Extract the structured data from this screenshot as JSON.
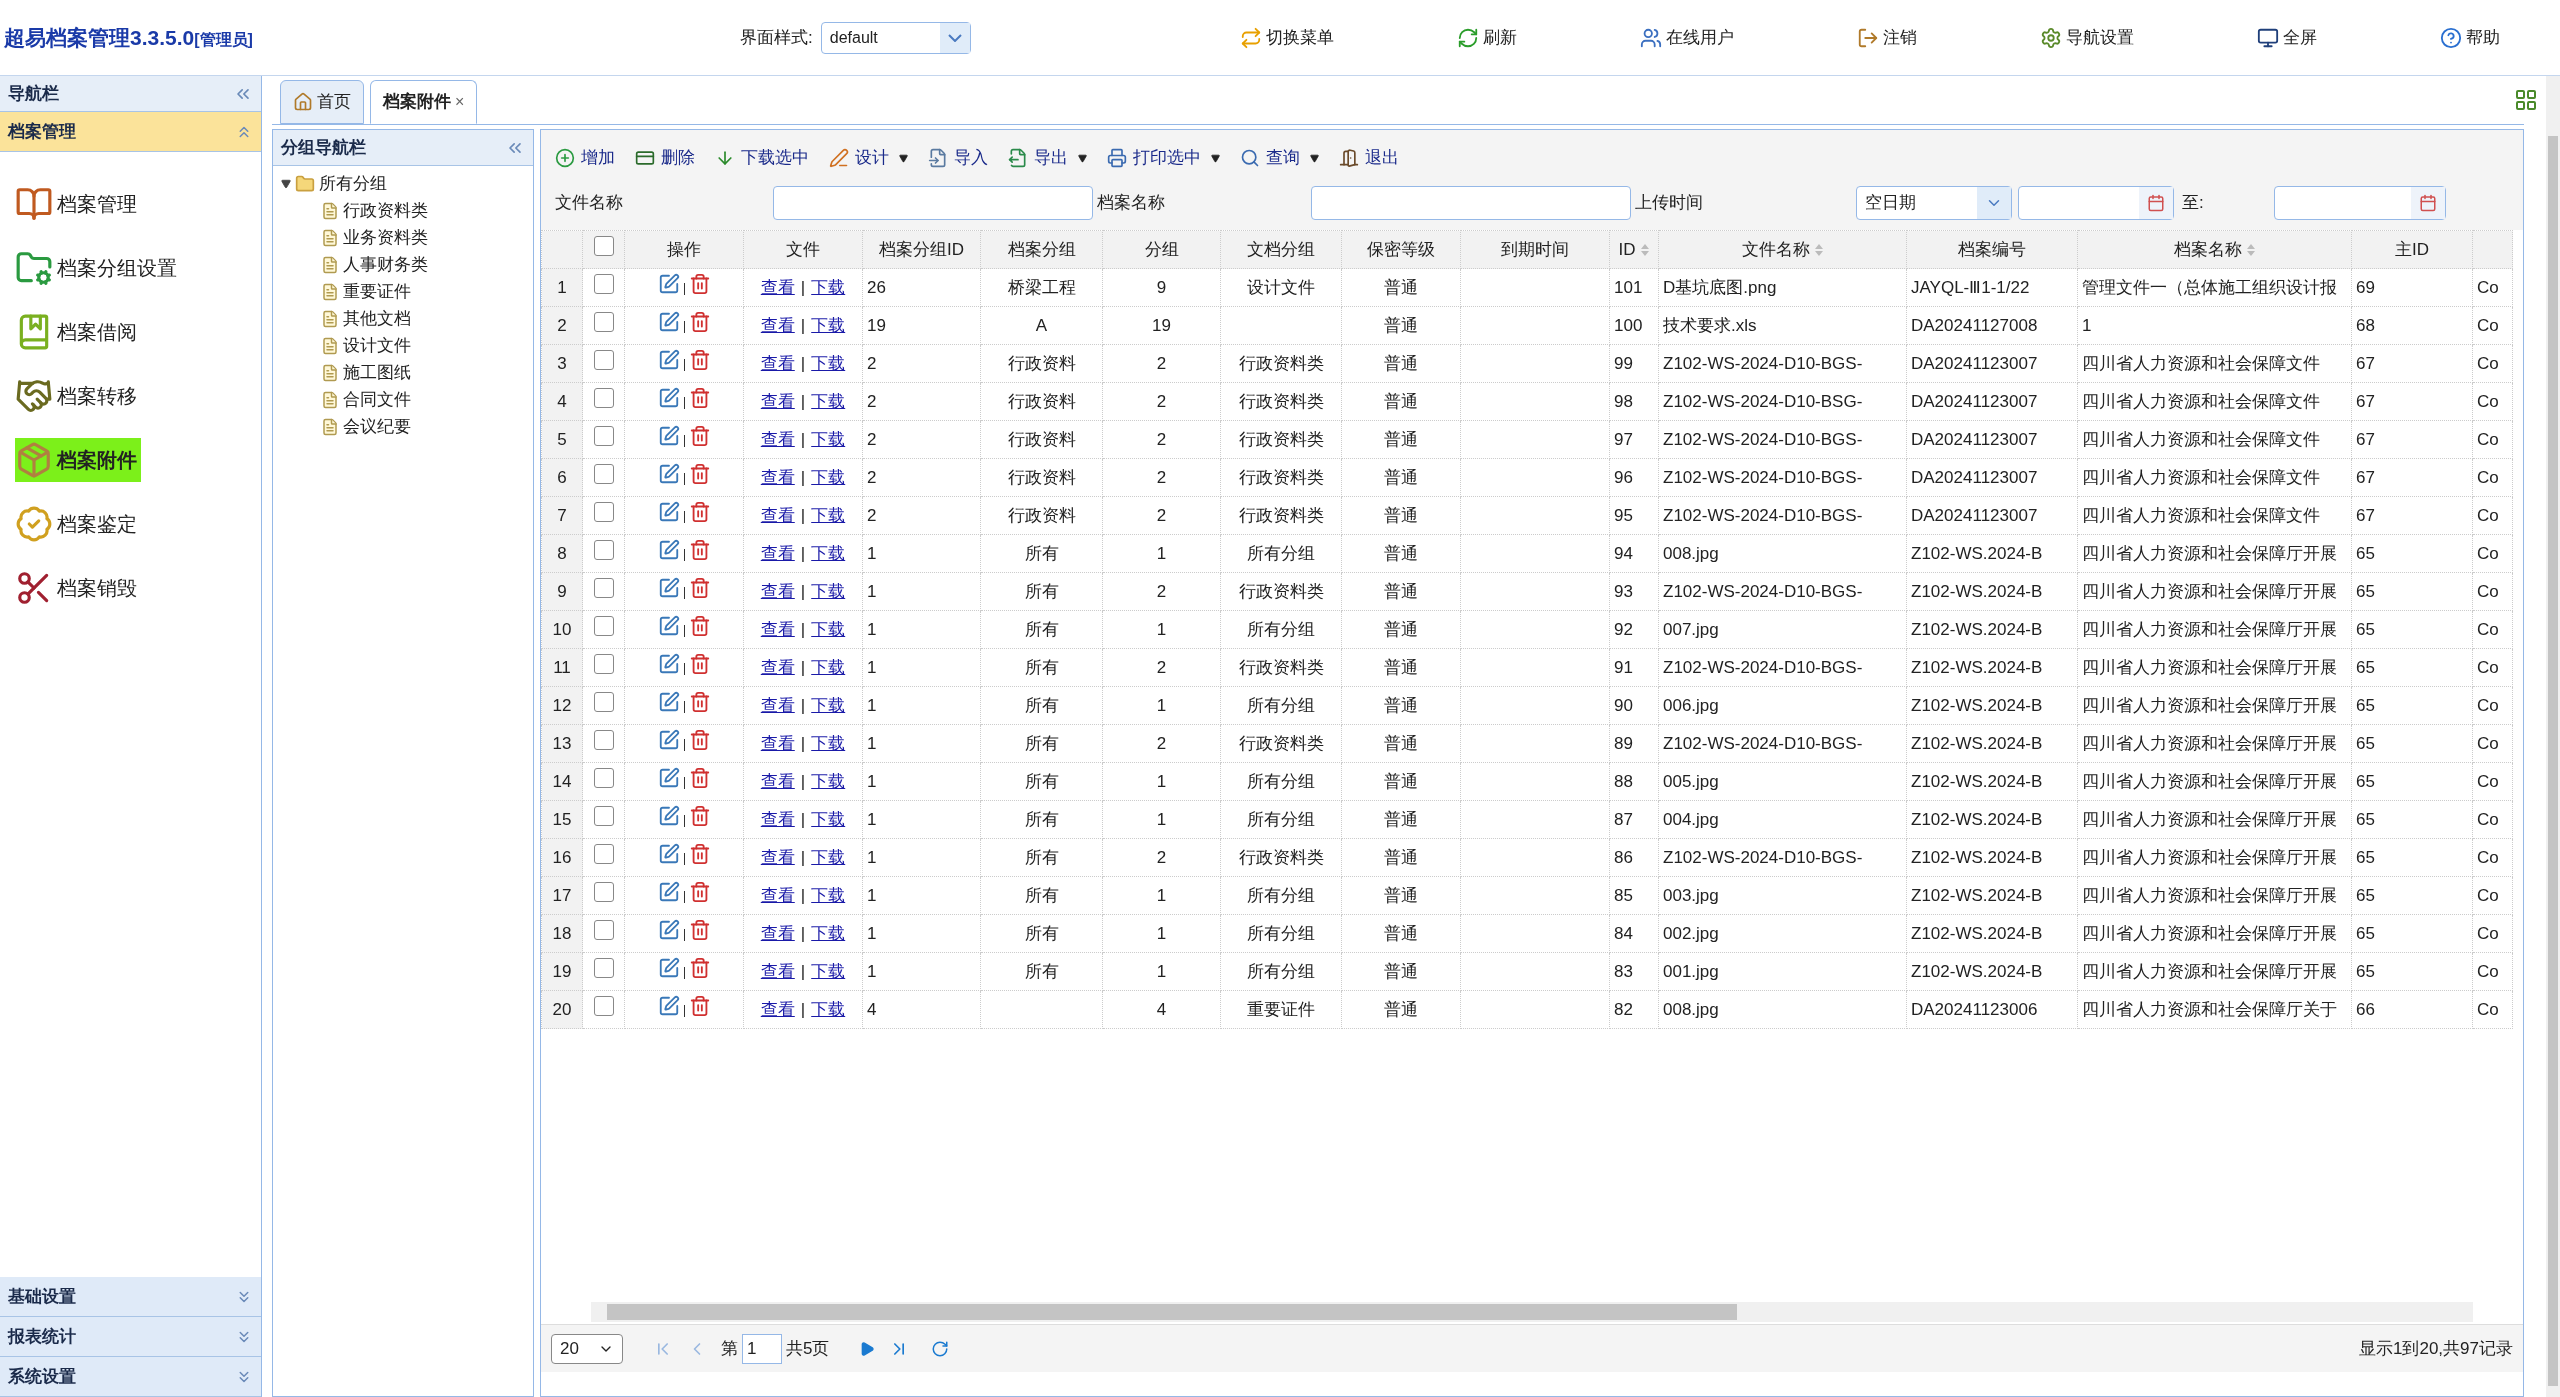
{
  "header": {
    "title": "超易档案管理3.3.5.0",
    "role": "[管理员]",
    "style_label": "界面样式:",
    "style_value": "default",
    "menu": [
      {
        "label": "切换菜单"
      },
      {
        "label": "刷新"
      },
      {
        "label": "在线用户"
      },
      {
        "label": "注销"
      },
      {
        "label": "导航设置"
      },
      {
        "label": "全屏"
      },
      {
        "label": "帮助"
      }
    ]
  },
  "nav": {
    "title": "导航栏",
    "sections_top": [
      {
        "label": "档案管理",
        "expanded": true
      }
    ],
    "items": [
      {
        "label": "档案管理",
        "selected": false
      },
      {
        "label": "档案分组设置",
        "selected": false
      },
      {
        "label": "档案借阅",
        "selected": false
      },
      {
        "label": "档案转移",
        "selected": false
      },
      {
        "label": "档案附件",
        "selected": true
      },
      {
        "label": "档案鉴定",
        "selected": false
      },
      {
        "label": "档案销毁",
        "selected": false
      }
    ],
    "sections_bottom": [
      {
        "label": "基础设置",
        "expanded": false
      },
      {
        "label": "报表统计",
        "expanded": false
      },
      {
        "label": "系统设置",
        "expanded": false
      }
    ]
  },
  "tabs": [
    {
      "label": "首页",
      "selected": false
    },
    {
      "label": "档案附件",
      "selected": true,
      "close": "×"
    }
  ],
  "group_nav": {
    "title": "分组导航栏",
    "tree": {
      "label": "所有分组",
      "expanded": true,
      "children": [
        {
          "label": "行政资料类"
        },
        {
          "label": "业务资料类"
        },
        {
          "label": "人事财务类"
        },
        {
          "label": "重要证件"
        },
        {
          "label": "其他文档"
        },
        {
          "label": "设计文件"
        },
        {
          "label": "施工图纸"
        },
        {
          "label": "合同文件"
        },
        {
          "label": "会议纪要"
        }
      ]
    }
  },
  "toolbar": [
    {
      "label": "增加",
      "dropdown": false
    },
    {
      "label": "删除",
      "dropdown": false
    },
    {
      "label": "下载选中",
      "dropdown": false
    },
    {
      "label": "设计",
      "dropdown": true
    },
    {
      "label": "导入",
      "dropdown": false
    },
    {
      "label": "导出",
      "dropdown": true
    },
    {
      "label": "打印选中",
      "dropdown": true
    },
    {
      "label": "查询",
      "dropdown": true
    },
    {
      "label": "退出",
      "dropdown": false
    }
  ],
  "filters": {
    "file_name_label": "文件名称",
    "archive_name_label": "档案名称",
    "upload_label": "上传时间",
    "date_mode": "空日期",
    "to_label": "至:"
  },
  "table": {
    "header_checked": false,
    "action_columns": [
      {
        "label": "操作"
      },
      {
        "label": "文件"
      }
    ],
    "columns": [
      {
        "label": "档案分组ID",
        "sortable": false
      },
      {
        "label": "档案分组",
        "sortable": false
      },
      {
        "label": "分组",
        "sortable": false
      },
      {
        "label": "文档分组",
        "sortable": false
      },
      {
        "label": "保密等级",
        "sortable": false
      },
      {
        "label": "到期时间",
        "sortable": false
      },
      {
        "label": "ID",
        "sortable": true
      },
      {
        "label": "文件名称",
        "sortable": true
      },
      {
        "label": "档案编号",
        "sortable": false
      },
      {
        "label": "档案名称",
        "sortable": true
      },
      {
        "label": "主ID",
        "sortable": false
      },
      {
        "sortable": false
      }
    ],
    "rows": [
      {
        "num": "1",
        "checked": false,
        "view": "查看",
        "sep": "|",
        "download": "下载",
        "cells": [
          "26",
          "桥梁工程",
          "9",
          "设计文件",
          "普通",
          null,
          "101",
          "D基坑底图.png",
          "JAYQL-Ⅲ1-1/22",
          "管理文件一（总体施工组织设计报",
          "69",
          "Co"
        ]
      },
      {
        "num": "2",
        "checked": false,
        "view": "查看",
        "sep": "|",
        "download": "下载",
        "cells": [
          "19",
          "A",
          "19",
          null,
          "普通",
          null,
          "100",
          "技术要求.xls",
          "DA20241127008",
          "1",
          "68",
          "Co"
        ]
      },
      {
        "num": "3",
        "checked": false,
        "view": "查看",
        "sep": "|",
        "download": "下载",
        "cells": [
          "2",
          "行政资料",
          "2",
          "行政资料类",
          "普通",
          null,
          "99",
          "Z102-WS-2024-D10-BGS-",
          "DA20241123007",
          "四川省人力资源和社会保障文件",
          "67",
          "Co"
        ]
      },
      {
        "num": "4",
        "checked": false,
        "view": "查看",
        "sep": "|",
        "download": "下载",
        "cells": [
          "2",
          "行政资料",
          "2",
          "行政资料类",
          "普通",
          null,
          "98",
          "Z102-WS-2024-D10-BSG-",
          "DA20241123007",
          "四川省人力资源和社会保障文件",
          "67",
          "Co"
        ]
      },
      {
        "num": "5",
        "checked": false,
        "view": "查看",
        "sep": "|",
        "download": "下载",
        "cells": [
          "2",
          "行政资料",
          "2",
          "行政资料类",
          "普通",
          null,
          "97",
          "Z102-WS-2024-D10-BGS-",
          "DA20241123007",
          "四川省人力资源和社会保障文件",
          "67",
          "Co"
        ]
      },
      {
        "num": "6",
        "checked": false,
        "view": "查看",
        "sep": "|",
        "download": "下载",
        "cells": [
          "2",
          "行政资料",
          "2",
          "行政资料类",
          "普通",
          null,
          "96",
          "Z102-WS-2024-D10-BGS-",
          "DA20241123007",
          "四川省人力资源和社会保障文件",
          "67",
          "Co"
        ]
      },
      {
        "num": "7",
        "checked": false,
        "view": "查看",
        "sep": "|",
        "download": "下载",
        "cells": [
          "2",
          "行政资料",
          "2",
          "行政资料类",
          "普通",
          null,
          "95",
          "Z102-WS-2024-D10-BGS-",
          "DA20241123007",
          "四川省人力资源和社会保障文件",
          "67",
          "Co"
        ]
      },
      {
        "num": "8",
        "checked": false,
        "view": "查看",
        "sep": "|",
        "download": "下载",
        "cells": [
          "1",
          "所有",
          "1",
          "所有分组",
          "普通",
          null,
          "94",
          "008.jpg",
          "Z102-WS.2024-B",
          "四川省人力资源和社会保障厅开展",
          "65",
          "Co"
        ]
      },
      {
        "num": "9",
        "checked": false,
        "view": "查看",
        "sep": "|",
        "download": "下载",
        "cells": [
          "1",
          "所有",
          "2",
          "行政资料类",
          "普通",
          null,
          "93",
          "Z102-WS-2024-D10-BGS-",
          "Z102-WS.2024-B",
          "四川省人力资源和社会保障厅开展",
          "65",
          "Co"
        ]
      },
      {
        "num": "10",
        "checked": false,
        "view": "查看",
        "sep": "|",
        "download": "下载",
        "cells": [
          "1",
          "所有",
          "1",
          "所有分组",
          "普通",
          null,
          "92",
          "007.jpg",
          "Z102-WS.2024-B",
          "四川省人力资源和社会保障厅开展",
          "65",
          "Co"
        ]
      },
      {
        "num": "11",
        "checked": false,
        "view": "查看",
        "sep": "|",
        "download": "下载",
        "cells": [
          "1",
          "所有",
          "2",
          "行政资料类",
          "普通",
          null,
          "91",
          "Z102-WS-2024-D10-BGS-",
          "Z102-WS.2024-B",
          "四川省人力资源和社会保障厅开展",
          "65",
          "Co"
        ]
      },
      {
        "num": "12",
        "checked": false,
        "view": "查看",
        "sep": "|",
        "download": "下载",
        "cells": [
          "1",
          "所有",
          "1",
          "所有分组",
          "普通",
          null,
          "90",
          "006.jpg",
          "Z102-WS.2024-B",
          "四川省人力资源和社会保障厅开展",
          "65",
          "Co"
        ]
      },
      {
        "num": "13",
        "checked": false,
        "view": "查看",
        "sep": "|",
        "download": "下载",
        "cells": [
          "1",
          "所有",
          "2",
          "行政资料类",
          "普通",
          null,
          "89",
          "Z102-WS-2024-D10-BGS-",
          "Z102-WS.2024-B",
          "四川省人力资源和社会保障厅开展",
          "65",
          "Co"
        ]
      },
      {
        "num": "14",
        "checked": false,
        "view": "查看",
        "sep": "|",
        "download": "下载",
        "cells": [
          "1",
          "所有",
          "1",
          "所有分组",
          "普通",
          null,
          "88",
          "005.jpg",
          "Z102-WS.2024-B",
          "四川省人力资源和社会保障厅开展",
          "65",
          "Co"
        ]
      },
      {
        "num": "15",
        "checked": false,
        "view": "查看",
        "sep": "|",
        "download": "下载",
        "cells": [
          "1",
          "所有",
          "1",
          "所有分组",
          "普通",
          null,
          "87",
          "004.jpg",
          "Z102-WS.2024-B",
          "四川省人力资源和社会保障厅开展",
          "65",
          "Co"
        ]
      },
      {
        "num": "16",
        "checked": false,
        "view": "查看",
        "sep": "|",
        "download": "下载",
        "cells": [
          "1",
          "所有",
          "2",
          "行政资料类",
          "普通",
          null,
          "86",
          "Z102-WS-2024-D10-BGS-",
          "Z102-WS.2024-B",
          "四川省人力资源和社会保障厅开展",
          "65",
          "Co"
        ]
      },
      {
        "num": "17",
        "checked": false,
        "view": "查看",
        "sep": "|",
        "download": "下载",
        "cells": [
          "1",
          "所有",
          "1",
          "所有分组",
          "普通",
          null,
          "85",
          "003.jpg",
          "Z102-WS.2024-B",
          "四川省人力资源和社会保障厅开展",
          "65",
          "Co"
        ]
      },
      {
        "num": "18",
        "checked": false,
        "view": "查看",
        "sep": "|",
        "download": "下载",
        "cells": [
          "1",
          "所有",
          "1",
          "所有分组",
          "普通",
          null,
          "84",
          "002.jpg",
          "Z102-WS.2024-B",
          "四川省人力资源和社会保障厅开展",
          "65",
          "Co"
        ]
      },
      {
        "num": "19",
        "checked": false,
        "view": "查看",
        "sep": "|",
        "download": "下载",
        "cells": [
          "1",
          "所有",
          "1",
          "所有分组",
          "普通",
          null,
          "83",
          "001.jpg",
          "Z102-WS.2024-B",
          "四川省人力资源和社会保障厅开展",
          "65",
          "Co"
        ]
      },
      {
        "num": "20",
        "checked": false,
        "view": "查看",
        "sep": "|",
        "download": "下载",
        "cells": [
          "4",
          null,
          "4",
          "重要证件",
          "普通",
          null,
          "82",
          "008.jpg",
          "DA20241123006",
          "四川省人力资源和社会保障厅关于",
          "66",
          "Co"
        ]
      }
    ]
  },
  "pager": {
    "page_size": "20",
    "page_prefix": "第",
    "page": "1",
    "page_suffix": "共5页",
    "summary": "显示1到20,共97记录"
  }
}
